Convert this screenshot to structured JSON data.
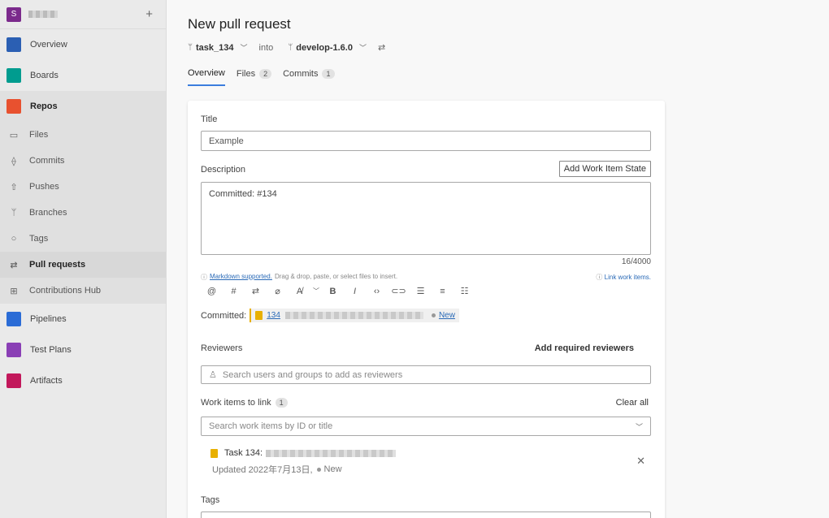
{
  "org": {
    "avatar_letter": "S"
  },
  "sidebar": {
    "items": [
      {
        "label": "Overview",
        "icon": "overview-icon",
        "color": "#2b5fb3"
      },
      {
        "label": "Boards",
        "icon": "boards-icon",
        "color": "#009c8f"
      },
      {
        "label": "Repos",
        "icon": "repos-icon",
        "color": "#e8512f"
      }
    ],
    "repo_items": [
      {
        "label": "Files",
        "icon": "file-icon"
      },
      {
        "label": "Commits",
        "icon": "commit-icon"
      },
      {
        "label": "Pushes",
        "icon": "push-icon"
      },
      {
        "label": "Branches",
        "icon": "branch-icon"
      },
      {
        "label": "Tags",
        "icon": "tag-icon"
      },
      {
        "label": "Pull requests",
        "icon": "pull-request-icon"
      },
      {
        "label": "Contributions Hub",
        "icon": "hub-icon"
      }
    ],
    "bottom_items": [
      {
        "label": "Pipelines",
        "icon": "pipelines-icon",
        "color": "#2b6cd6"
      },
      {
        "label": "Test Plans",
        "icon": "test-plans-icon",
        "color": "#8a3fb5"
      },
      {
        "label": "Artifacts",
        "icon": "artifacts-icon",
        "color": "#c2185b"
      }
    ]
  },
  "header": {
    "title": "New pull request",
    "source_branch": "task_134",
    "into": "into",
    "target_branch": "develop-1.6.0"
  },
  "tabs": [
    {
      "label": "Overview"
    },
    {
      "label": "Files",
      "count": "2"
    },
    {
      "label": "Commits",
      "count": "1"
    }
  ],
  "form": {
    "title_label": "Title",
    "title_value": "Example",
    "description_label": "Description",
    "add_state_button": "Add Work Item State",
    "description_value": "Committed: #134",
    "counter": "16/4000",
    "markdown_link": "Markdown supported.",
    "markdown_hint": "Drag & drop, paste, or select files to insert.",
    "link_work_items": "Link work items.",
    "committed_label": "Committed:",
    "work_item_id": "134",
    "work_item_state": "New",
    "reviewers_label": "Reviewers",
    "add_required_reviewers": "Add required reviewers",
    "reviewers_placeholder": "Search users and groups to add as reviewers",
    "work_items_label": "Work items to link",
    "work_items_count": "1",
    "clear_all": "Clear all",
    "work_items_placeholder": "Search work items by ID or title",
    "linked_item_title": "Task 134:",
    "linked_item_updated": "Updated 2022年7月13日,",
    "linked_item_state": "New",
    "tags_label": "Tags"
  }
}
